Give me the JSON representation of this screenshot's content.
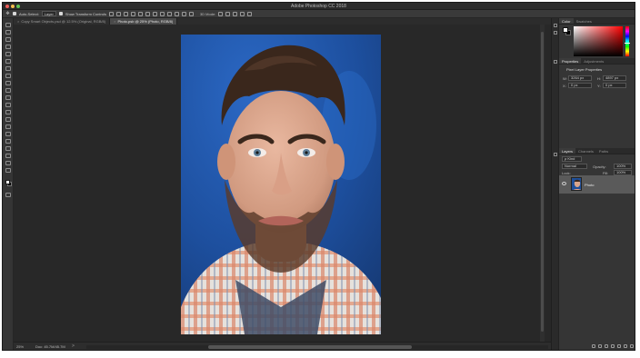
{
  "window": {
    "title": "Adobe Photoshop CC 2018"
  },
  "options_bar": {
    "auto_select_label": "Auto-Select:",
    "auto_select_value": "Layer",
    "transform_label": "Show Transform Controls",
    "mode_3d": "3D Mode:"
  },
  "tabs": [
    {
      "label": "Copy Smart Objects.psd @ 12.5% (Original, RGB/8)",
      "active": false
    },
    {
      "label": "Photo.psb @ 25% (Photo, RGB/8)",
      "active": true
    }
  ],
  "status": {
    "zoom": "25%",
    "doc": "Doc: 45.7M/45.7M",
    "arrow": ">"
  },
  "panels": {
    "color_tabs": [
      "Color",
      "Swatches"
    ],
    "properties_tabs": [
      "Properties",
      "Adjustments"
    ],
    "properties_title": "Pixel Layer Properties",
    "w_label": "W:",
    "w_value": "3264 px",
    "h_label": "H:",
    "h_value": "4897 px",
    "x_label": "X:",
    "x_value": "0 px",
    "y_label": "Y:",
    "y_value": "0 px",
    "layers_tabs": [
      "Layers",
      "Channels",
      "Paths"
    ],
    "kind": "ρ Kind",
    "blend_mode": "Normal",
    "opacity_label": "Opacity:",
    "opacity_value": "100%",
    "lock_label": "Lock:",
    "fill_label": "Fill:",
    "fill_value": "100%",
    "layer_name": "Photo"
  }
}
